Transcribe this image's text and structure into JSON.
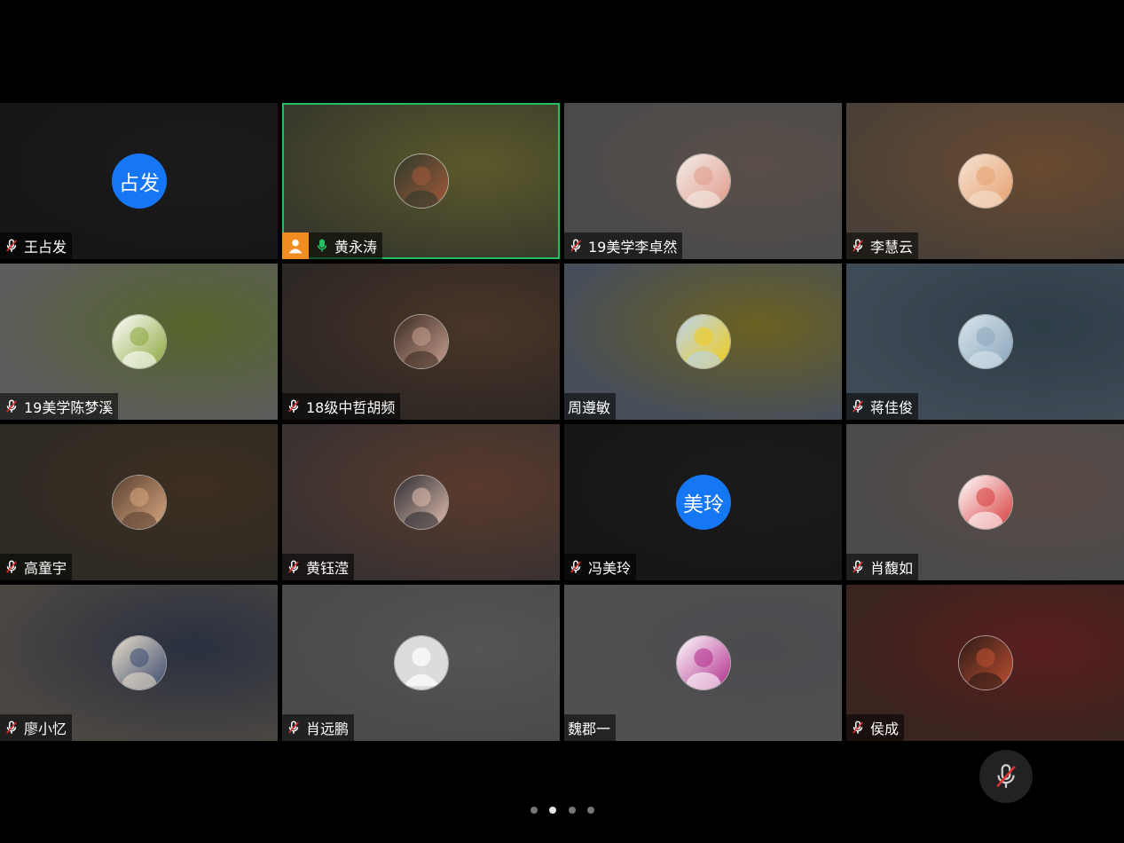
{
  "participants": [
    {
      "name": "王占发",
      "mic": "muted",
      "avatar_text": "占发",
      "bg": "#161616",
      "bg2": "#1b1b1b",
      "avatar": "letters"
    },
    {
      "name": "黄永涛",
      "mic": "speaking",
      "host": true,
      "active": true,
      "bg": "#3a3a2c",
      "bg2": "#5b5a2b",
      "avatar": "photo-boy-reading",
      "c1": "#2b3a2a",
      "c2": "#a55a3a"
    },
    {
      "name": "19美学李卓然",
      "mic": "muted",
      "bg": "#4a4a4a",
      "bg2": "#5a4f48",
      "avatar": "photo-anime-girl",
      "c1": "#f3ede8",
      "c2": "#e09a8a"
    },
    {
      "name": "李慧云",
      "mic": "muted",
      "bg": "#4b4037",
      "bg2": "#6a4a30",
      "avatar": "photo-child",
      "c1": "#f5e3d2",
      "c2": "#e7a070"
    },
    {
      "name": "19美学陈梦溪",
      "mic": "muted",
      "bg": "#5c5c5c",
      "bg2": "#55652a",
      "avatar": "photo-duck",
      "c1": "#ffffff",
      "c2": "#8aa63a"
    },
    {
      "name": "18级中哲胡频",
      "mic": "muted",
      "bg": "#2e2824",
      "bg2": "#4a3528",
      "avatar": "photo-girl-desk",
      "c1": "#3a2a22",
      "c2": "#c9a090"
    },
    {
      "name": "周遵敏",
      "mic": "none",
      "bg": "#474e5a",
      "bg2": "#6a6120",
      "avatar": "photo-flowers",
      "c1": "#b8d4ee",
      "c2": "#f2cc1a"
    },
    {
      "name": "蒋佳俊",
      "mic": "muted",
      "bg": "#3e4a55",
      "bg2": "#2f3d48",
      "avatar": "photo-seascape",
      "c1": "#d8e4ec",
      "c2": "#8aa6bb"
    },
    {
      "name": "高童宇",
      "mic": "muted",
      "bg": "#2e2a24",
      "bg2": "#3d2f20",
      "avatar": "photo-portrait",
      "c1": "#5a4030",
      "c2": "#d9a880"
    },
    {
      "name": "黄钰滢",
      "mic": "muted",
      "bg": "#3a3230",
      "bg2": "#5a3a2c",
      "avatar": "photo-woman",
      "c1": "#2a2a30",
      "c2": "#e2c0b0"
    },
    {
      "name": "冯美玲",
      "mic": "muted",
      "avatar_text": "美玲",
      "bg": "#161616",
      "bg2": "#1b1b1b",
      "avatar": "letters"
    },
    {
      "name": "肖馥如",
      "mic": "muted",
      "bg": "#4a4a4a",
      "bg2": "#5a4a45",
      "avatar": "photo-cartoon",
      "c1": "#ffffff",
      "c2": "#d83a3a"
    },
    {
      "name": "廖小忆",
      "mic": "muted",
      "bg": "#4a4642",
      "bg2": "#2a3040",
      "avatar": "photo-illustration",
      "c1": "#e8dcc8",
      "c2": "#3a4a70"
    },
    {
      "name": "肖远鹏",
      "mic": "muted",
      "bg": "#4a4a4a",
      "bg2": "#555555",
      "avatar": "default-user",
      "c1": "#dcdcdc",
      "c2": "#f5f5f5"
    },
    {
      "name": "魏郡一",
      "mic": "none",
      "bg": "#505050",
      "bg2": "#4d4a4f",
      "avatar": "photo-cat",
      "c1": "#ffffff",
      "c2": "#b02a8a"
    },
    {
      "name": "侯成",
      "mic": "muted",
      "bg": "#3a2420",
      "bg2": "#5a1e1e",
      "avatar": "photo-dog",
      "c1": "#2a1a18",
      "c2": "#c05030"
    }
  ],
  "pagination": {
    "pages": 4,
    "current": 2
  },
  "colors": {
    "host_border": "#22c063",
    "avatar_blue": "#1677f5",
    "muted_slash": "#e03030",
    "mic_green": "#22c063",
    "host_badge": "#f08c21"
  },
  "controls": {
    "mute_icon": "mic-off-icon"
  }
}
